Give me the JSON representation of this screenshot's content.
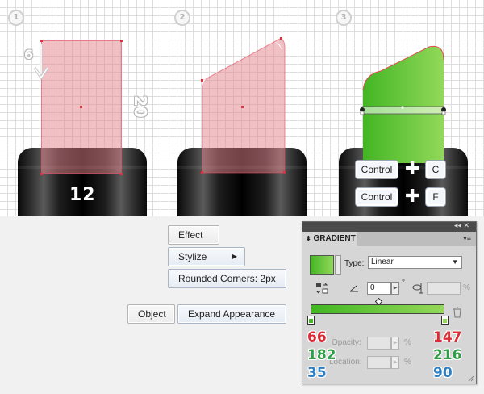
{
  "steps": {
    "step1": "1",
    "step2": "2",
    "step3": "3"
  },
  "annotations": {
    "move_label": "6",
    "height_label": "20",
    "cap_number": "12"
  },
  "shortcuts": {
    "row1": {
      "modifier": "Control",
      "plus": "✚",
      "key": "C"
    },
    "row2": {
      "modifier": "Control",
      "plus": "✚",
      "key": "F"
    }
  },
  "menu": {
    "effect": "Effect",
    "stylize": "Stylize",
    "stylize_arrow": "▶",
    "rounded_corners": "Rounded Corners: 2px",
    "object": "Object",
    "expand_appearance": "Expand Appearance"
  },
  "gradient_panel": {
    "topbar_controls": "◂◂ ✕",
    "title": "GRADIENT",
    "title_icon": "⬍",
    "menu_icon": "▾≡",
    "type_label": "Type:",
    "type_value": "Linear",
    "type_arrow": "▼",
    "angle_value": "0",
    "degree_symbol": "°",
    "stepper_arrow": "▶",
    "percent": "%",
    "opacity_label": "Opacity:",
    "location_label": "Location:",
    "start_color": {
      "r": "66",
      "g": "182",
      "b": "35"
    },
    "end_color": {
      "r": "147",
      "g": "216",
      "b": "90"
    },
    "gradient_start_hex": "#42B623",
    "gradient_end_hex": "#93D85A"
  }
}
